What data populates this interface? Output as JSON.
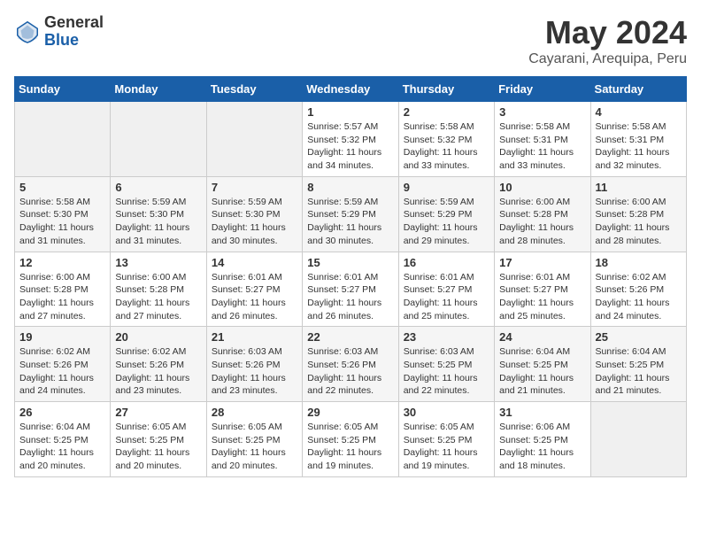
{
  "header": {
    "logo_general": "General",
    "logo_blue": "Blue",
    "month_year": "May 2024",
    "location": "Cayarani, Arequipa, Peru"
  },
  "days_of_week": [
    "Sunday",
    "Monday",
    "Tuesday",
    "Wednesday",
    "Thursday",
    "Friday",
    "Saturday"
  ],
  "weeks": [
    [
      {
        "day": "",
        "info": ""
      },
      {
        "day": "",
        "info": ""
      },
      {
        "day": "",
        "info": ""
      },
      {
        "day": "1",
        "info": "Sunrise: 5:57 AM\nSunset: 5:32 PM\nDaylight: 11 hours\nand 34 minutes."
      },
      {
        "day": "2",
        "info": "Sunrise: 5:58 AM\nSunset: 5:32 PM\nDaylight: 11 hours\nand 33 minutes."
      },
      {
        "day": "3",
        "info": "Sunrise: 5:58 AM\nSunset: 5:31 PM\nDaylight: 11 hours\nand 33 minutes."
      },
      {
        "day": "4",
        "info": "Sunrise: 5:58 AM\nSunset: 5:31 PM\nDaylight: 11 hours\nand 32 minutes."
      }
    ],
    [
      {
        "day": "5",
        "info": "Sunrise: 5:58 AM\nSunset: 5:30 PM\nDaylight: 11 hours\nand 31 minutes."
      },
      {
        "day": "6",
        "info": "Sunrise: 5:59 AM\nSunset: 5:30 PM\nDaylight: 11 hours\nand 31 minutes."
      },
      {
        "day": "7",
        "info": "Sunrise: 5:59 AM\nSunset: 5:30 PM\nDaylight: 11 hours\nand 30 minutes."
      },
      {
        "day": "8",
        "info": "Sunrise: 5:59 AM\nSunset: 5:29 PM\nDaylight: 11 hours\nand 30 minutes."
      },
      {
        "day": "9",
        "info": "Sunrise: 5:59 AM\nSunset: 5:29 PM\nDaylight: 11 hours\nand 29 minutes."
      },
      {
        "day": "10",
        "info": "Sunrise: 6:00 AM\nSunset: 5:28 PM\nDaylight: 11 hours\nand 28 minutes."
      },
      {
        "day": "11",
        "info": "Sunrise: 6:00 AM\nSunset: 5:28 PM\nDaylight: 11 hours\nand 28 minutes."
      }
    ],
    [
      {
        "day": "12",
        "info": "Sunrise: 6:00 AM\nSunset: 5:28 PM\nDaylight: 11 hours\nand 27 minutes."
      },
      {
        "day": "13",
        "info": "Sunrise: 6:00 AM\nSunset: 5:28 PM\nDaylight: 11 hours\nand 27 minutes."
      },
      {
        "day": "14",
        "info": "Sunrise: 6:01 AM\nSunset: 5:27 PM\nDaylight: 11 hours\nand 26 minutes."
      },
      {
        "day": "15",
        "info": "Sunrise: 6:01 AM\nSunset: 5:27 PM\nDaylight: 11 hours\nand 26 minutes."
      },
      {
        "day": "16",
        "info": "Sunrise: 6:01 AM\nSunset: 5:27 PM\nDaylight: 11 hours\nand 25 minutes."
      },
      {
        "day": "17",
        "info": "Sunrise: 6:01 AM\nSunset: 5:27 PM\nDaylight: 11 hours\nand 25 minutes."
      },
      {
        "day": "18",
        "info": "Sunrise: 6:02 AM\nSunset: 5:26 PM\nDaylight: 11 hours\nand 24 minutes."
      }
    ],
    [
      {
        "day": "19",
        "info": "Sunrise: 6:02 AM\nSunset: 5:26 PM\nDaylight: 11 hours\nand 24 minutes."
      },
      {
        "day": "20",
        "info": "Sunrise: 6:02 AM\nSunset: 5:26 PM\nDaylight: 11 hours\nand 23 minutes."
      },
      {
        "day": "21",
        "info": "Sunrise: 6:03 AM\nSunset: 5:26 PM\nDaylight: 11 hours\nand 23 minutes."
      },
      {
        "day": "22",
        "info": "Sunrise: 6:03 AM\nSunset: 5:26 PM\nDaylight: 11 hours\nand 22 minutes."
      },
      {
        "day": "23",
        "info": "Sunrise: 6:03 AM\nSunset: 5:25 PM\nDaylight: 11 hours\nand 22 minutes."
      },
      {
        "day": "24",
        "info": "Sunrise: 6:04 AM\nSunset: 5:25 PM\nDaylight: 11 hours\nand 21 minutes."
      },
      {
        "day": "25",
        "info": "Sunrise: 6:04 AM\nSunset: 5:25 PM\nDaylight: 11 hours\nand 21 minutes."
      }
    ],
    [
      {
        "day": "26",
        "info": "Sunrise: 6:04 AM\nSunset: 5:25 PM\nDaylight: 11 hours\nand 20 minutes."
      },
      {
        "day": "27",
        "info": "Sunrise: 6:05 AM\nSunset: 5:25 PM\nDaylight: 11 hours\nand 20 minutes."
      },
      {
        "day": "28",
        "info": "Sunrise: 6:05 AM\nSunset: 5:25 PM\nDaylight: 11 hours\nand 20 minutes."
      },
      {
        "day": "29",
        "info": "Sunrise: 6:05 AM\nSunset: 5:25 PM\nDaylight: 11 hours\nand 19 minutes."
      },
      {
        "day": "30",
        "info": "Sunrise: 6:05 AM\nSunset: 5:25 PM\nDaylight: 11 hours\nand 19 minutes."
      },
      {
        "day": "31",
        "info": "Sunrise: 6:06 AM\nSunset: 5:25 PM\nDaylight: 11 hours\nand 18 minutes."
      },
      {
        "day": "",
        "info": ""
      }
    ]
  ]
}
